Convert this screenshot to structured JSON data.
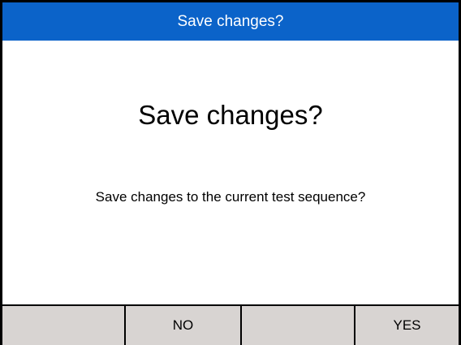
{
  "dialog": {
    "title": "Save changes?",
    "heading": "Save changes?",
    "message": "Save changes to the current test sequence?"
  },
  "softkeys": [
    {
      "label": ""
    },
    {
      "label": "NO"
    },
    {
      "label": ""
    },
    {
      "label": "YES"
    }
  ],
  "colors": {
    "titlebar": "#0b63c9",
    "softkey_bar": "#d8d4d2"
  }
}
